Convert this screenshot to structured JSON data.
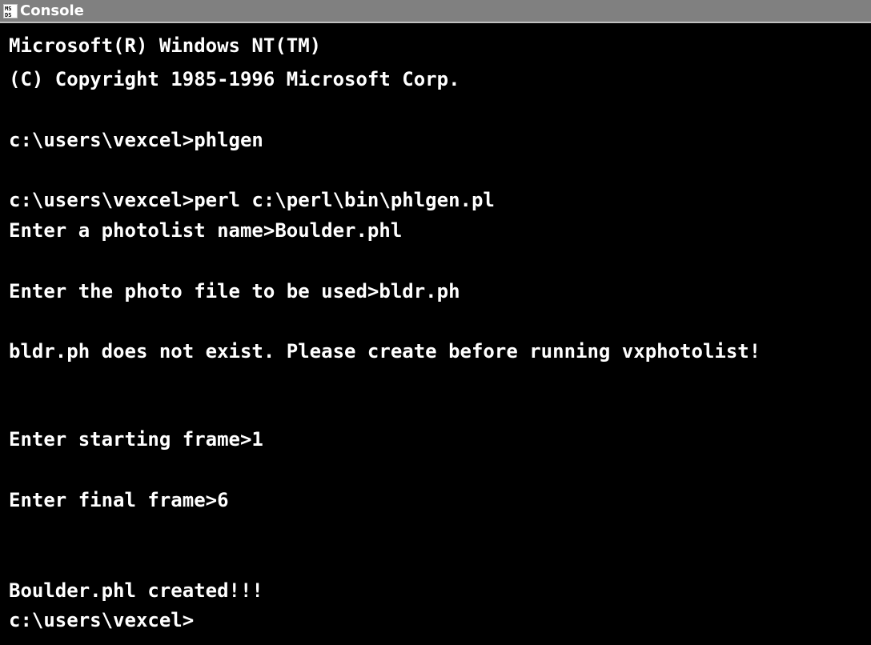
{
  "window": {
    "title": "Console",
    "icon": "ms-dos-icon"
  },
  "console": {
    "lines": [
      "Microsoft(R) Windows NT(TM)",
      "(C) Copyright 1985-1996 Microsoft Corp.",
      "",
      "c:\\users\\vexcel>phlgen",
      "",
      "c:\\users\\vexcel>perl c:\\perl\\bin\\phlgen.pl",
      "Enter a photolist name>Boulder.phl",
      "",
      "Enter the photo file to be used>bldr.ph",
      "",
      "bldr.ph does not exist. Please create before running vxphotolist!",
      "",
      "",
      "Enter starting frame>1",
      "",
      "Enter final frame>6",
      "",
      "",
      "Boulder.phl created!!!",
      "c:\\users\\vexcel>"
    ]
  },
  "colors": {
    "background": "#000000",
    "text": "#ffffff",
    "titlebar": "#808080"
  }
}
